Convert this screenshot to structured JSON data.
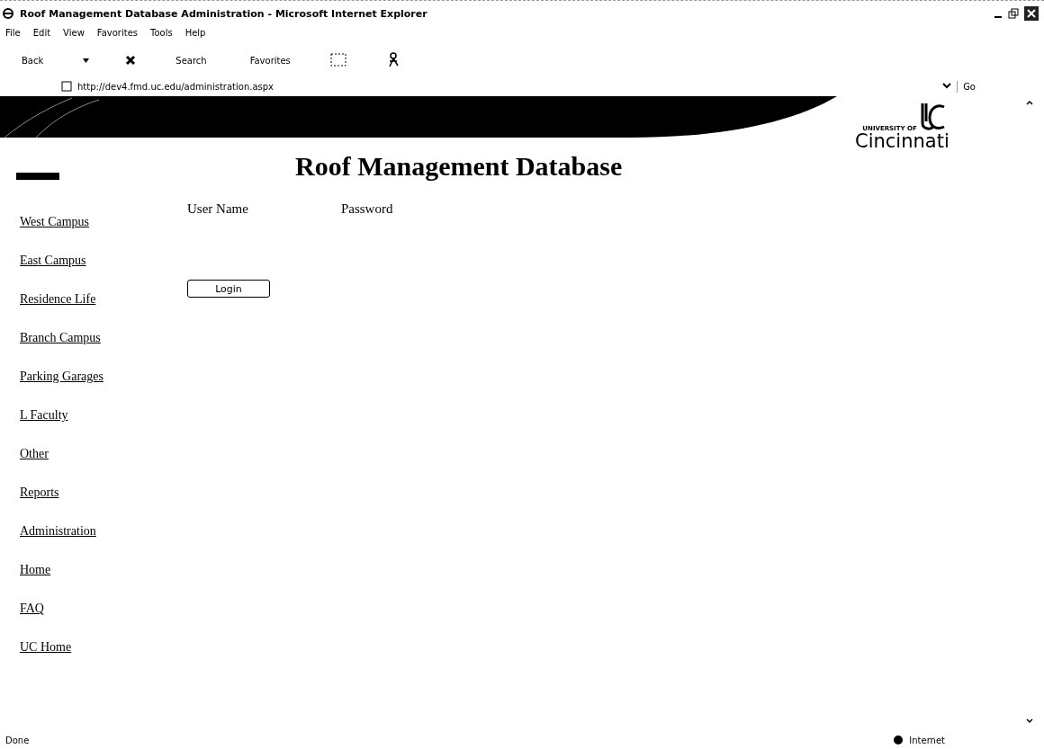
{
  "window": {
    "title": "Roof Management Database Administration - Microsoft Internet Explorer"
  },
  "menu": [
    "File",
    "Edit",
    "View",
    "Favorites",
    "Tools",
    "Help"
  ],
  "toolbar": {
    "back": "Back",
    "search": "Search",
    "favorites": "Favorites"
  },
  "address": {
    "url": "http://dev4.fmd.uc.edu/administration.aspx",
    "go": "Go"
  },
  "logo": {
    "small": "UNIVERSITY OF",
    "name": "Cincinnati"
  },
  "heading": "Roof Management Database",
  "nav": [
    "West Campus",
    "East Campus",
    "Residence Life",
    "Branch Campus",
    "Parking Garages",
    "L Faculty",
    "Other",
    "Reports",
    "Administration",
    "Home",
    "FAQ",
    "UC Home"
  ],
  "login": {
    "user_label": "User Name",
    "password_label": "Password",
    "button": "Login"
  },
  "status_bar": {
    "text": "Done",
    "zone": "Internet"
  }
}
